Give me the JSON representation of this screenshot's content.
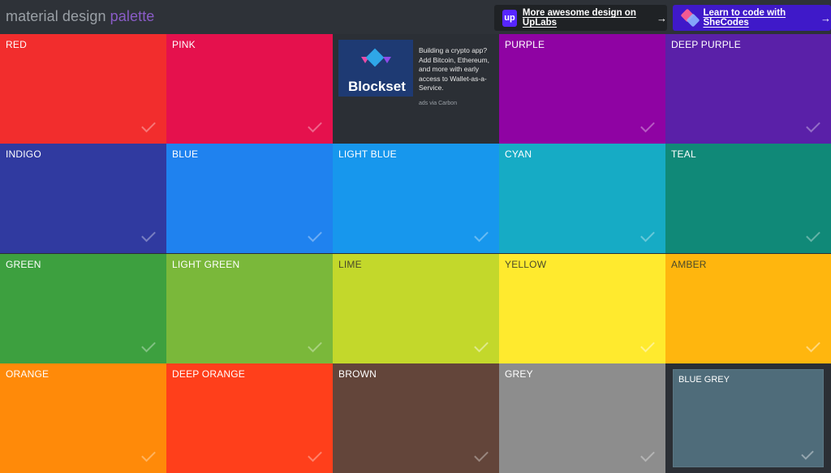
{
  "header": {
    "logo_part1": "material design",
    "logo_part2": "palette",
    "uplabs": {
      "icon_text": "up",
      "label": "More awesome design on UpLabs",
      "arrow": "→"
    },
    "shecodes": {
      "label": "Learn to code with SheCodes",
      "arrow": "→"
    }
  },
  "ad": {
    "brand": "Blockset",
    "text": "Building a crypto app? Add Bitcoin, Ethereum, and more with early access to Wallet-as-a-Service.",
    "via": "ads via Carbon"
  },
  "colors": [
    {
      "name": "RED",
      "hex": "#f22d2d"
    },
    {
      "name": "PINK",
      "hex": "#e5114d"
    },
    {
      "name": "PURPLE",
      "hex": "#8f03a3"
    },
    {
      "name": "DEEP PURPLE",
      "hex": "#5a20a8"
    },
    {
      "name": "INDIGO",
      "hex": "#303aa0"
    },
    {
      "name": "BLUE",
      "hex": "#1f82ef"
    },
    {
      "name": "LIGHT BLUE",
      "hex": "#1797ed"
    },
    {
      "name": "CYAN",
      "hex": "#16abc5"
    },
    {
      "name": "TEAL",
      "hex": "#108978"
    },
    {
      "name": "GREEN",
      "hex": "#3da03f"
    },
    {
      "name": "LIGHT GREEN",
      "hex": "#7ab83a"
    },
    {
      "name": "LIME",
      "hex": "#c3d82b"
    },
    {
      "name": "YELLOW",
      "hex": "#ffea2e"
    },
    {
      "name": "AMBER",
      "hex": "#ffb60e"
    },
    {
      "name": "ORANGE",
      "hex": "#ff8a09"
    },
    {
      "name": "DEEP ORANGE",
      "hex": "#ff3f1b"
    },
    {
      "name": "BROWN",
      "hex": "#63453a"
    },
    {
      "name": "GREY",
      "hex": "#8d8d8d"
    },
    {
      "name": "BLUE GREY",
      "hex": "#4f6c7a"
    }
  ]
}
